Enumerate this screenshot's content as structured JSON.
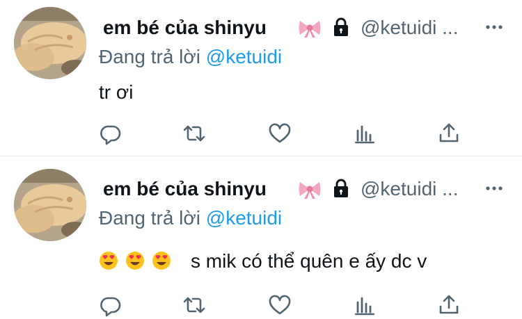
{
  "tweets": [
    {
      "display_name": "em bé của shinyu",
      "handle": "@ketuidi ...",
      "reply_prefix": "Đang trả lời ",
      "reply_mention": "@ketuidi",
      "text": "tr ơi",
      "emojis": []
    },
    {
      "display_name": "em bé của shinyu",
      "handle": "@ketuidi ...",
      "reply_prefix": "Đang trả lời ",
      "reply_mention": "@ketuidi",
      "text": "s mik có thể quên e ấy dc v",
      "emojis": [
        "heart-eyes-emoji",
        "heart-eyes-emoji",
        "heart-eyes-emoji"
      ]
    }
  ],
  "icons": {
    "bow": "pink-bow-icon",
    "lock": "lock-icon",
    "more": "more-icon",
    "reply": "reply-icon",
    "retweet": "retweet-icon",
    "like": "heart-icon",
    "views": "views-icon",
    "share": "share-icon"
  },
  "colors": {
    "text": "#0f1419",
    "secondary": "#536471",
    "mention": "#1d9bf0",
    "icon": "#536471",
    "divider": "#e1e8ed"
  }
}
